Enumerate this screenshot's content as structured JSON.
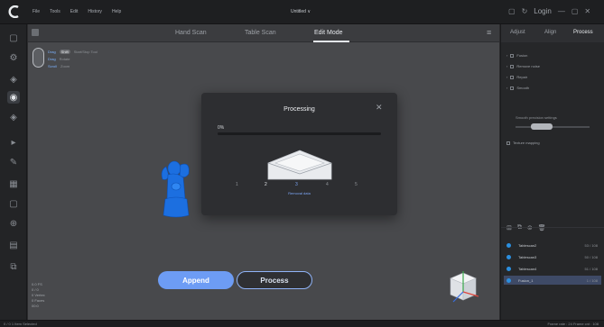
{
  "app": {
    "logo_icon": "app-logo-icon",
    "menu": [
      "File",
      "Tools",
      "Edit",
      "History",
      "Help"
    ],
    "document_title": "Untitled ∨",
    "login_label": "Login",
    "accent_color": "#6d9cf4"
  },
  "mode_tabs": [
    {
      "label": "Hand Scan",
      "active": false
    },
    {
      "label": "Table Scan",
      "active": false
    },
    {
      "label": "Edit Mode",
      "active": true
    }
  ],
  "mouse_help": {
    "rows": [
      {
        "key": "Drag",
        "chip": "Shift",
        "desc": "Start/Stop Tool"
      },
      {
        "key": "Drag",
        "desc": "Rotate"
      },
      {
        "key": "Scroll",
        "desc": "Zoom"
      }
    ]
  },
  "viewport": {
    "stats": [
      "0.0 FS",
      "0 / 0",
      "0 Vertex",
      "0 Faces",
      "00:0"
    ]
  },
  "actions": {
    "append_label": "Append",
    "process_label": "Process"
  },
  "dialog": {
    "title": "Processing",
    "progress_text": "0%",
    "progress_value": 0,
    "steps": [
      "1",
      "2",
      "3",
      "4",
      "5",
      "6"
    ],
    "current_step_index": 2,
    "step_label": "Removal data"
  },
  "right_panel": {
    "tabs": [
      {
        "label": "Adjust",
        "active": false
      },
      {
        "label": "Align",
        "active": false
      },
      {
        "label": "Process",
        "active": true
      }
    ],
    "options": [
      {
        "label": "Fusion"
      },
      {
        "label": "Remove noise"
      },
      {
        "label": "Repair"
      },
      {
        "label": "Smooth"
      }
    ],
    "smooth_label": "Smooth precision settings",
    "smooth_value": 0.3,
    "texture_option": "Texture mapping",
    "list_tool_icons": [
      "add-icon",
      "copy-icon",
      "merge-icon",
      "delete-icon"
    ],
    "scans": [
      {
        "name": "Tablescan2",
        "count": "53 / 108",
        "selected": false
      },
      {
        "name": "Tablescan3",
        "count": "50 / 108",
        "selected": false
      },
      {
        "name": "Tablescan4",
        "count": "51 / 108",
        "selected": false
      },
      {
        "name": "Fusion_1",
        "count": "1 / 108",
        "selected": true
      }
    ]
  },
  "status": {
    "left": "0 / 0   1 Item Selected",
    "right": "Frame rate : 24   Frame cnt : 108"
  }
}
